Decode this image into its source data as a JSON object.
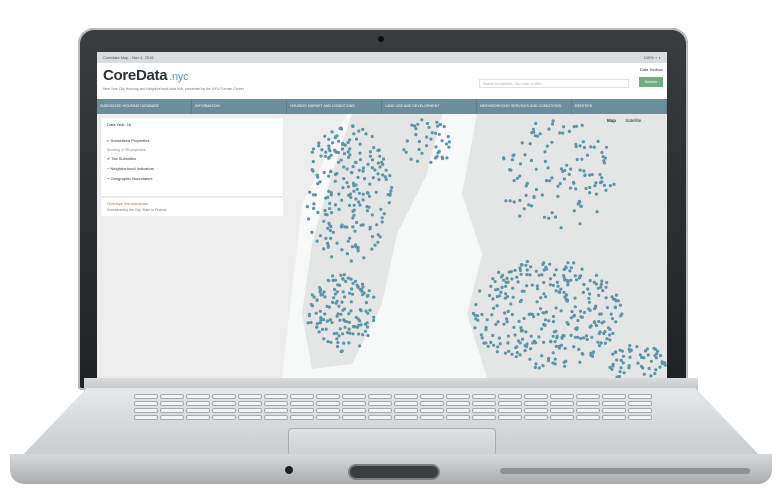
{
  "os_bar": {
    "tab_title": "Coredata Map - Nov 4, 2016",
    "status": "100% ⌁ ◐"
  },
  "app": {
    "logo": "CoreData",
    "logo_suffix": ".nyc",
    "tagline": "New York City Housing and Neighborhood data hub, presented by the NYU Furman Center",
    "search_placeholder": "Search for Address, Zip Code, or BBL",
    "header_links": "Data   Toolbox",
    "header_button": "Search"
  },
  "nav": {
    "items": [
      "SUBSIDIZED HOUSING DATABASE",
      "INFORMATION",
      "HOUSING MARKET AND CONDITIONS",
      "LAND USE AND DEVELOPMENT",
      "NEIGHBORHOOD SERVICES AND CONDITIONS",
      "RENTERS"
    ]
  },
  "panel": {
    "filter": "Data Year: 16",
    "layer_title": "Subsidized Properties",
    "subtitle": "Showing 4,795 properties",
    "tax_label": "Tax Subsidies",
    "neighborhood_label": "Neighborhood Indicators",
    "geographic_label": "Geographic Boundaries",
    "overlay_title": "Overlays Visualizations",
    "overlay_sub": "Subsidized by the City, State or Federal"
  },
  "map": {
    "map_label": "Map",
    "satellite_label": "Satellite",
    "point_color": "#5e95a6",
    "land_color": "#e6e8e7",
    "water_color": "#f7f8f8"
  }
}
